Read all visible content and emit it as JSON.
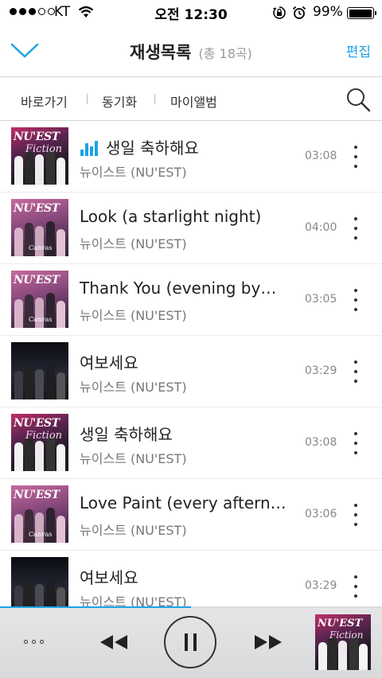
{
  "status_bar": {
    "carrier": "KT",
    "time": "오전 12:30",
    "battery_percent": "99%",
    "battery_level": 0.99,
    "icons": [
      "signal-dots-icon",
      "wifi-icon",
      "rotation-lock-icon",
      "alarm-icon",
      "battery-icon"
    ]
  },
  "header": {
    "collapse_icon": "chevron-down-icon",
    "title": "재생목록",
    "count": "(총 18곡)",
    "edit_label": "편집",
    "accent_color": "#1aa3e8"
  },
  "toolbar": {
    "items": [
      {
        "label": "바로가기"
      },
      {
        "label": "동기화"
      },
      {
        "label": "마이앨범"
      }
    ],
    "search_icon": "search-icon"
  },
  "songs": [
    {
      "title": "생일 축하해요",
      "artist": "뉴이스트 (NU'EST)",
      "duration": "03:08",
      "playing": true,
      "art": "fiction"
    },
    {
      "title": "Look (a starlight night)",
      "artist": "뉴이스트 (NU'EST)",
      "duration": "04:00",
      "playing": false,
      "art": "canvas"
    },
    {
      "title": "Thank You (evening by…",
      "artist": "뉴이스트 (NU'EST)",
      "duration": "03:05",
      "playing": false,
      "art": "canvas"
    },
    {
      "title": "여보세요",
      "artist": "뉴이스트 (NU'EST)",
      "duration": "03:29",
      "playing": false,
      "art": "street"
    },
    {
      "title": "생일 축하해요",
      "artist": "뉴이스트 (NU'EST)",
      "duration": "03:08",
      "playing": false,
      "art": "fiction"
    },
    {
      "title": "Love Paint (every aftern…",
      "artist": "뉴이스트 (NU'EST)",
      "duration": "03:06",
      "playing": false,
      "art": "canvas"
    },
    {
      "title": "여보세요",
      "artist": "뉴이스트 (NU'EST)",
      "duration": "03:29",
      "playing": false,
      "art": "street"
    }
  ],
  "album_art_text": {
    "fiction": {
      "line1": "NU'EST",
      "line2": "Fiction"
    },
    "canvas": {
      "line1": "NU'EST",
      "line2": "",
      "line3": "Canvas"
    },
    "street": {
      "line1": "",
      "line2": ""
    }
  },
  "player": {
    "progress": 0.5,
    "more_icon": "more-horizontal-icon",
    "prev_icon": "rewind-icon",
    "pause_icon": "pause-icon",
    "next_icon": "fast-forward-icon",
    "now_playing_art": "fiction"
  }
}
